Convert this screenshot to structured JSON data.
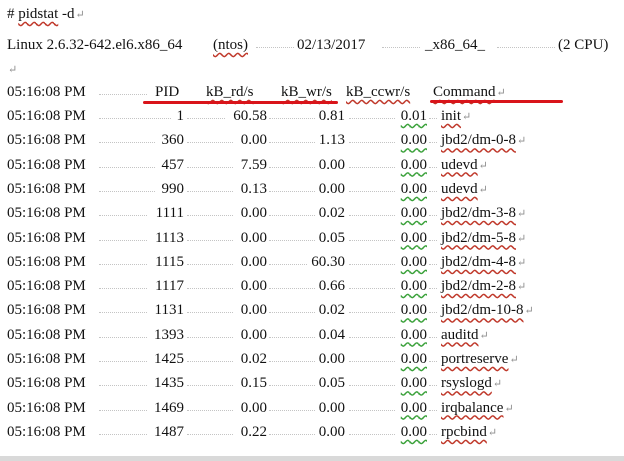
{
  "command_line": "# pidstat -d",
  "sys_info": {
    "kernel": "Linux 2.6.32-642.el6.x86_64",
    "host": "(ntos)",
    "date": "02/13/2017",
    "arch": "_x86_64_",
    "cpus": "(2 CPU)"
  },
  "header": {
    "time": "05:16:08 PM",
    "pid": "PID",
    "kb_rd": "kB_rd/s",
    "kb_wr": "kB_wr/s",
    "kb_ccwr": "kB_ccwr/s",
    "command": "Command"
  },
  "rows": [
    {
      "time": "05:16:08 PM",
      "pid": "1",
      "kb_rd": "60.58",
      "kb_wr": "0.81",
      "kb_ccwr": "0.01",
      "command": "init"
    },
    {
      "time": "05:16:08 PM",
      "pid": "360",
      "kb_rd": "0.00",
      "kb_wr": "1.13",
      "kb_ccwr": "0.00",
      "command": "jbd2/dm-0-8"
    },
    {
      "time": "05:16:08 PM",
      "pid": "457",
      "kb_rd": "7.59",
      "kb_wr": "0.00",
      "kb_ccwr": "0.00",
      "command": "udevd"
    },
    {
      "time": "05:16:08 PM",
      "pid": "990",
      "kb_rd": "0.13",
      "kb_wr": "0.00",
      "kb_ccwr": "0.00",
      "command": "udevd"
    },
    {
      "time": "05:16:08 PM",
      "pid": "1111",
      "kb_rd": "0.00",
      "kb_wr": "0.02",
      "kb_ccwr": "0.00",
      "command": "jbd2/dm-3-8"
    },
    {
      "time": "05:16:08 PM",
      "pid": "1113",
      "kb_rd": "0.00",
      "kb_wr": "0.05",
      "kb_ccwr": "0.00",
      "command": "jbd2/dm-5-8"
    },
    {
      "time": "05:16:08 PM",
      "pid": "1115",
      "kb_rd": "0.00",
      "kb_wr": "60.30",
      "kb_ccwr": "0.00",
      "command": "jbd2/dm-4-8"
    },
    {
      "time": "05:16:08 PM",
      "pid": "1117",
      "kb_rd": "0.00",
      "kb_wr": "0.66",
      "kb_ccwr": "0.00",
      "command": "jbd2/dm-2-8"
    },
    {
      "time": "05:16:08 PM",
      "pid": "1131",
      "kb_rd": "0.00",
      "kb_wr": "0.02",
      "kb_ccwr": "0.00",
      "command": "jbd2/dm-10-8"
    },
    {
      "time": "05:16:08 PM",
      "pid": "1393",
      "kb_rd": "0.00",
      "kb_wr": "0.04",
      "kb_ccwr": "0.00",
      "command": "auditd"
    },
    {
      "time": "05:16:08 PM",
      "pid": "1425",
      "kb_rd": "0.02",
      "kb_wr": "0.00",
      "kb_ccwr": "0.00",
      "command": "portreserve"
    },
    {
      "time": "05:16:08 PM",
      "pid": "1435",
      "kb_rd": "0.15",
      "kb_wr": "0.05",
      "kb_ccwr": "0.00",
      "command": "rsyslogd"
    },
    {
      "time": "05:16:08 PM",
      "pid": "1469",
      "kb_rd": "0.00",
      "kb_wr": "0.00",
      "kb_ccwr": "0.00",
      "command": "irqbalance"
    },
    {
      "time": "05:16:08 PM",
      "pid": "1487",
      "kb_rd": "0.22",
      "kb_wr": "0.00",
      "kb_ccwr": "0.00",
      "command": "rpcbind"
    }
  ],
  "paragraph_mark": "↵",
  "colors": {
    "highlight_underline": "#d9141a",
    "spell_squiggle": "#c0392b",
    "grammar_squiggle": "#3aa13a",
    "dotted_leader": "#c4c4c4"
  }
}
